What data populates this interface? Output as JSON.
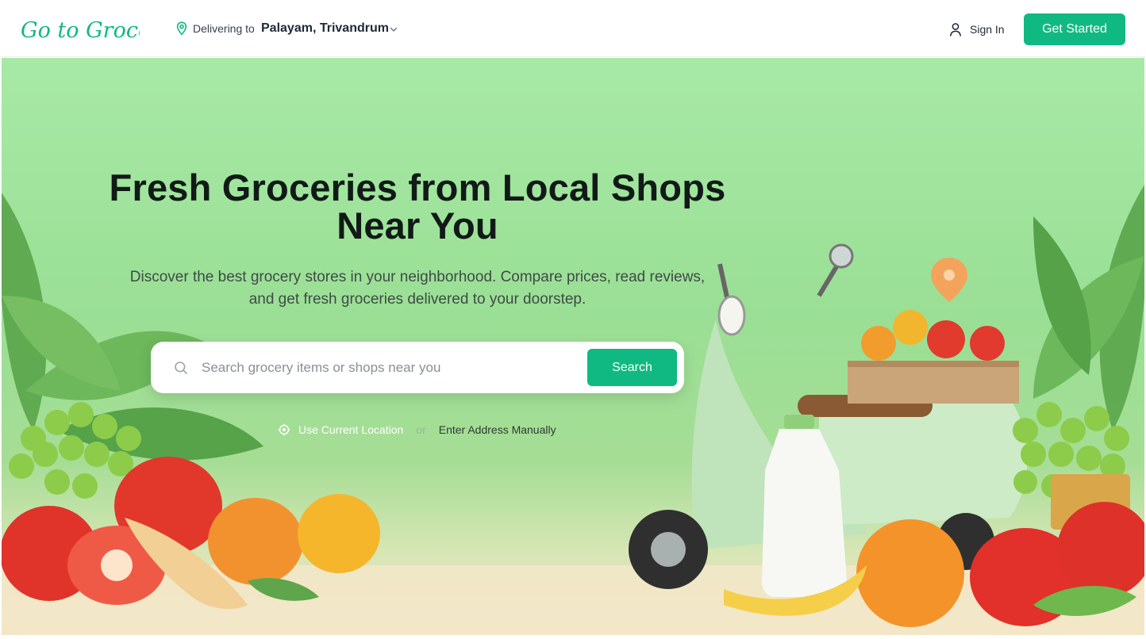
{
  "brand": {
    "logo_text": "Go to Grocery",
    "accent_color": "#10b981"
  },
  "header": {
    "delivering_label": "Delivering to",
    "location": "Palayam, Trivandrum",
    "sign_in": "Sign In",
    "get_started": "Get Started"
  },
  "hero": {
    "title_line1": "Fresh Groceries from Local Shops",
    "title_line2": "Near You",
    "subtitle_line1": "Discover the best grocery stores in your neighborhood. Compare prices, read reviews,",
    "subtitle_line2": "and get fresh groceries delivered to your doorstep.",
    "search": {
      "placeholder": "Search grocery items or shops near you",
      "button": "Search"
    },
    "location_options": {
      "current": "Use Current Location",
      "or": "or",
      "manual": "Enter Address Manually"
    }
  },
  "icons": {
    "location": "map-pin-icon",
    "dropdown": "chevron-down-icon",
    "user": "user-icon",
    "search": "search-icon",
    "gps": "target-icon"
  }
}
